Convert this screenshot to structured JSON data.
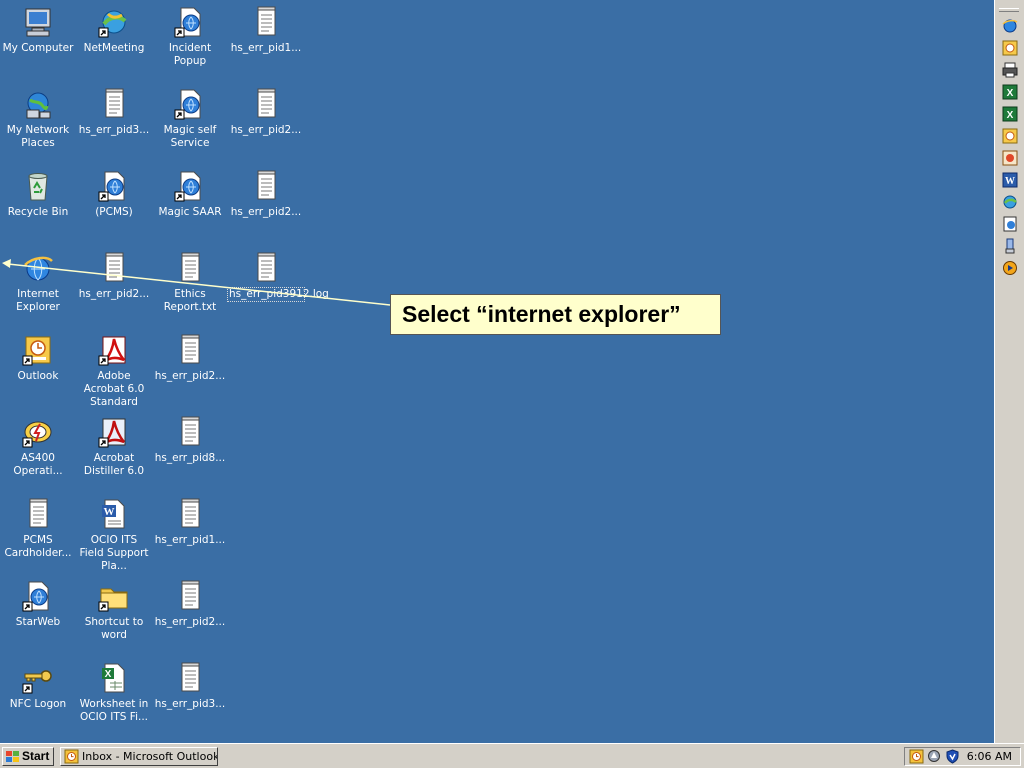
{
  "desktop": {
    "icons": [
      {
        "label": "My Computer",
        "icon": "my-computer-icon",
        "shortcut": false
      },
      {
        "label": "NetMeeting",
        "icon": "netmeeting-icon",
        "shortcut": true
      },
      {
        "label": "Incident Popup",
        "icon": "ie-document-icon",
        "shortcut": true
      },
      {
        "label": "hs_err_pid1...",
        "icon": "text-file-icon",
        "shortcut": false
      },
      {
        "label": "My Network Places",
        "icon": "network-places-icon",
        "shortcut": false
      },
      {
        "label": "hs_err_pid3...",
        "icon": "text-file-icon",
        "shortcut": false
      },
      {
        "label": "Magic self Service",
        "icon": "ie-document-icon",
        "shortcut": true
      },
      {
        "label": "hs_err_pid2...",
        "icon": "text-file-icon",
        "shortcut": false
      },
      {
        "label": "Recycle Bin",
        "icon": "recycle-bin-icon",
        "shortcut": false
      },
      {
        "label": "(PCMS)",
        "icon": "ie-document-icon",
        "shortcut": true
      },
      {
        "label": "Magic SAAR",
        "icon": "ie-document-icon",
        "shortcut": true
      },
      {
        "label": "hs_err_pid2...",
        "icon": "text-file-icon",
        "shortcut": false
      },
      {
        "label": "Internet Explorer",
        "icon": "internet-explorer-icon",
        "shortcut": false
      },
      {
        "label": "hs_err_pid2...",
        "icon": "text-file-icon",
        "shortcut": false
      },
      {
        "label": "Ethics Report.txt",
        "icon": "text-file-icon",
        "shortcut": false
      },
      {
        "label": "hs_err_pid3912.log",
        "icon": "text-file-icon",
        "shortcut": false,
        "selected": true
      },
      {
        "label": "Outlook",
        "icon": "outlook-icon",
        "shortcut": true
      },
      {
        "label": "Adobe Acrobat 6.0 Standard",
        "icon": "acrobat-icon",
        "shortcut": true
      },
      {
        "label": "hs_err_pid2...",
        "icon": "text-file-icon",
        "shortcut": false
      },
      {
        "label": "AS400 Operati...",
        "icon": "as400-icon",
        "shortcut": true
      },
      {
        "label": "Acrobat Distiller 6.0",
        "icon": "acrobat-distiller-icon",
        "shortcut": true
      },
      {
        "label": "hs_err_pid8...",
        "icon": "text-file-icon",
        "shortcut": false
      },
      {
        "label": "PCMS Cardholder...",
        "icon": "text-file-icon",
        "shortcut": false
      },
      {
        "label": "OCIO ITS Field Support Pla...",
        "icon": "word-document-icon",
        "shortcut": false
      },
      {
        "label": "hs_err_pid1...",
        "icon": "text-file-icon",
        "shortcut": false
      },
      {
        "label": "StarWeb",
        "icon": "ie-document-icon",
        "shortcut": true
      },
      {
        "label": "Shortcut to word",
        "icon": "folder-icon",
        "shortcut": true
      },
      {
        "label": "hs_err_pid2...",
        "icon": "text-file-icon",
        "shortcut": false
      },
      {
        "label": "NFC Logon",
        "icon": "key-icon",
        "shortcut": true
      },
      {
        "label": "Worksheet in OCIO ITS Fi...",
        "icon": "excel-worksheet-icon",
        "shortcut": false
      },
      {
        "label": "hs_err_pid3...",
        "icon": "text-file-icon",
        "shortcut": false
      }
    ]
  },
  "callout": {
    "text": "Select “internet explorer”"
  },
  "quick_launch": [
    "internet-explorer-icon",
    "outlook-icon",
    "printer-icon",
    "excel-icon",
    "excel-icon",
    "outlook-icon",
    "media-icon",
    "word-icon",
    "netmeeting-icon",
    "ie-document-icon",
    "network-icon",
    "media-player-icon"
  ],
  "taskbar": {
    "start_label": "Start",
    "tasks": [
      {
        "label": "Inbox - Microsoft Outlook",
        "icon": "outlook-icon"
      }
    ],
    "tray_icons": [
      "outlook-icon",
      "sound-icon",
      "shield-icon"
    ],
    "clock": "6:06 AM"
  },
  "colors": {
    "desktop": "#3a6ea5",
    "callout_bg": "#ffffcc",
    "taskbar": "#d4d0c8"
  }
}
